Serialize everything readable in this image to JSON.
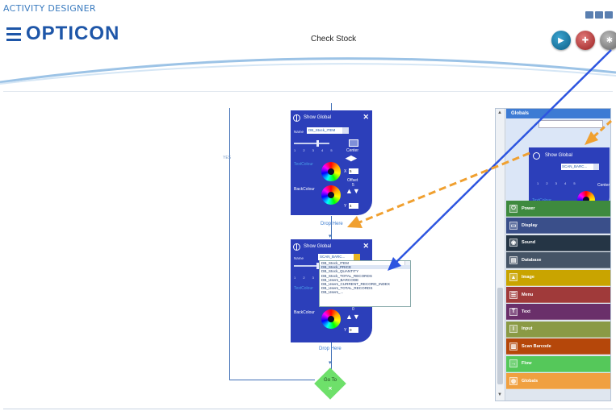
{
  "app": {
    "designer_title": "ACTIVITY DESIGNER",
    "logo_text": "OPTICON",
    "screen_title": "Check Stock"
  },
  "flow": {
    "yes_label": "YES",
    "drop_here_1": "Drop Here",
    "drop_here_2": "Drop Here",
    "goto_label": "Go To",
    "goto_close": "✕"
  },
  "block1": {
    "title": "Show Global",
    "close": "✕",
    "name_label": "Name",
    "name_value": "DB_Stock_ITEM",
    "ticks": "1 2 3 4 5",
    "center_label": "Center",
    "textcolour_label": "TextColour",
    "backcolour_label": "BackColour",
    "x_label": "X",
    "x_value": "5",
    "offset_label": "Offset",
    "offset_value": "5",
    "y_label": "Y",
    "y_value": "4"
  },
  "block2": {
    "title": "Show Global",
    "close": "✕",
    "name_label": "Name",
    "name_value": "SCAN_BARC...",
    "ticks": "1 2 3 4 5",
    "textcolour_label": "TextColour",
    "backcolour_label": "BackColour",
    "offset_value": "0",
    "y_label": "Y",
    "y_value": "0"
  },
  "dropdown_options": [
    "DB_Stock_ITEM",
    "DB_Stock_PRICE",
    "DB_Stock_QUANTITY",
    "DB_Stock_TOTAL_RECORDS",
    "DB_Users_BARCODE",
    "DB_Users_CURRENT_RECORD_INDEX",
    "DB_Users_TOTAL_RECORDS",
    "DB_Users_..."
  ],
  "palette": {
    "header": "Globals",
    "preview_title": "Show Global",
    "preview_name": "SCAN_BARC...",
    "preview_ticks": "1 2 3 4 5",
    "preview_center": "Center",
    "preview_textcolour": "TextColour",
    "categories": [
      {
        "label": "Power",
        "icon": "⏻",
        "color": "#3e8a3e"
      },
      {
        "label": "Display",
        "icon": "▭",
        "color": "#3a4f8a"
      },
      {
        "label": "Sound",
        "icon": "◉",
        "color": "#253545"
      },
      {
        "label": "Database",
        "icon": "▤",
        "color": "#455466"
      },
      {
        "label": "Image",
        "icon": "▲",
        "color": "#c9a400"
      },
      {
        "label": "Menu",
        "icon": "☰",
        "color": "#a03a3a"
      },
      {
        "label": "Text",
        "icon": "T",
        "color": "#6a2f6a"
      },
      {
        "label": "Input",
        "icon": "I",
        "color": "#8a9a45"
      },
      {
        "label": "Scan Barcode",
        "icon": "▥",
        "color": "#b5470a"
      },
      {
        "label": "Flow",
        "icon": "→",
        "color": "#55c85a"
      },
      {
        "label": "Globals",
        "icon": "◍",
        "color": "#f0a040"
      }
    ]
  }
}
